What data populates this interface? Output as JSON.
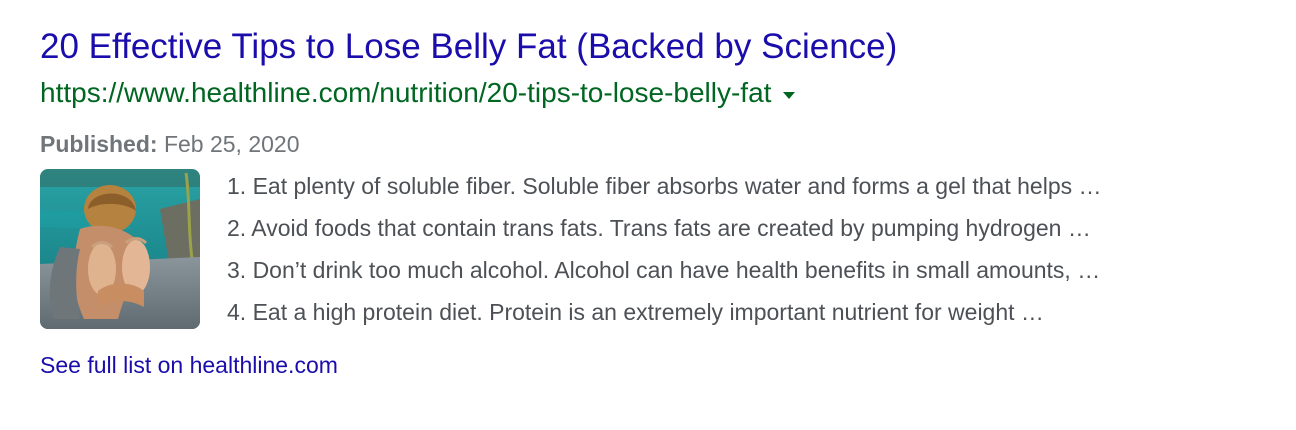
{
  "result": {
    "title": "20 Effective Tips to Lose Belly Fat (Backed by Science)",
    "url": "https://www.healthline.com/nutrition/20-tips-to-lose-belly-fat",
    "published_label": "Published:",
    "published_date": "Feb 25, 2020",
    "list_items": [
      "1. Eat plenty of soluble fiber. Soluble fiber absorbs water and forms a gel that helps …",
      "2. Avoid foods that contain trans fats. Trans fats are created by pumping hydrogen …",
      "3. Don’t drink too much alcohol. Alcohol can have health benefits in small amounts, …",
      "4. Eat a high protein diet. Protein is an extremely important nutrient for weight …"
    ],
    "more_link": "See full list on healthline.com"
  },
  "colors": {
    "title": "#1a0dab",
    "url": "#006621",
    "text": "#4d5156",
    "muted": "#70757a"
  },
  "icons": {
    "url_menu": "caret-down-icon"
  }
}
